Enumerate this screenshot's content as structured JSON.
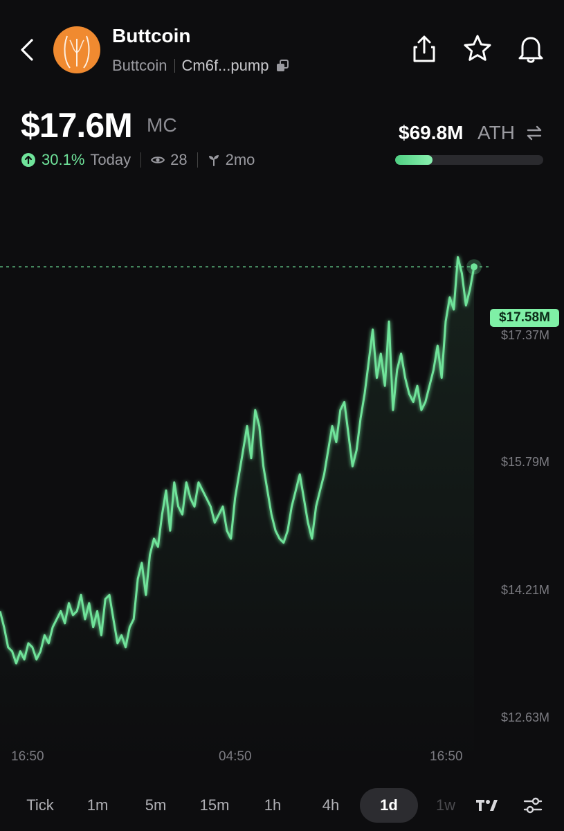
{
  "header": {
    "token_name": "Buttcoin",
    "token_symbol": "Buttcoin",
    "contract_short": "Cm6f...pump",
    "icons": [
      "chevron-left-icon",
      "share-icon",
      "star-icon",
      "bell-icon",
      "copy-icon"
    ]
  },
  "market": {
    "mc_value": "$17.6M",
    "mc_label": "MC",
    "change_pct": "30.1%",
    "change_period": "Today",
    "watchers": "28",
    "age": "2mo",
    "ath_value": "$69.8M",
    "ath_label": "ATH",
    "ath_progress_fraction": 0.25,
    "accent_color": "#6fe39a"
  },
  "chart_data": {
    "type": "line",
    "current_price_label": "$17.58M",
    "y_tick_labels": [
      "$17.37M",
      "$15.79M",
      "$14.21M",
      "$12.63M"
    ],
    "y_ticks": [
      17.37,
      15.79,
      14.21,
      12.63
    ],
    "x_tick_labels": [
      "16:50",
      "04:50",
      "16:50"
    ],
    "ylim": [
      12.03,
      17.97
    ],
    "series": [
      {
        "values": [
          13.3,
          13.1,
          12.85,
          12.8,
          12.65,
          12.8,
          12.7,
          12.9,
          12.85,
          12.7,
          12.8,
          13.0,
          12.9,
          13.1,
          13.2,
          13.3,
          13.15,
          13.4,
          13.25,
          13.3,
          13.5,
          13.2,
          13.4,
          13.1,
          13.3,
          13.0,
          13.45,
          13.5,
          13.2,
          12.9,
          13.0,
          12.85,
          13.1,
          13.2,
          13.7,
          13.9,
          13.5,
          14.0,
          14.2,
          14.1,
          14.5,
          14.8,
          14.3,
          14.9,
          14.6,
          14.5,
          14.9,
          14.7,
          14.6,
          14.9,
          14.8,
          14.7,
          14.6,
          14.4,
          14.5,
          14.6,
          14.3,
          14.2,
          14.7,
          15.0,
          15.3,
          15.6,
          15.2,
          15.8,
          15.6,
          15.1,
          14.8,
          14.5,
          14.3,
          14.2,
          14.15,
          14.3,
          14.6,
          14.8,
          15.0,
          14.7,
          14.4,
          14.2,
          14.6,
          14.8,
          15.0,
          15.3,
          15.6,
          15.4,
          15.8,
          15.9,
          15.5,
          15.1,
          15.3,
          15.7,
          16.0,
          16.4,
          16.8,
          16.2,
          16.5,
          16.1,
          16.9,
          15.8,
          16.3,
          16.5,
          16.2,
          16.0,
          15.9,
          16.1,
          15.8,
          15.9,
          16.1,
          16.3,
          16.6,
          16.2,
          16.9,
          17.2,
          17.05,
          17.7,
          17.5,
          17.1,
          17.3,
          17.58
        ]
      }
    ]
  },
  "timeframes": {
    "items": [
      "Tick",
      "1m",
      "5m",
      "15m",
      "1h",
      "4h",
      "1d",
      "1w"
    ],
    "active": "1d"
  }
}
